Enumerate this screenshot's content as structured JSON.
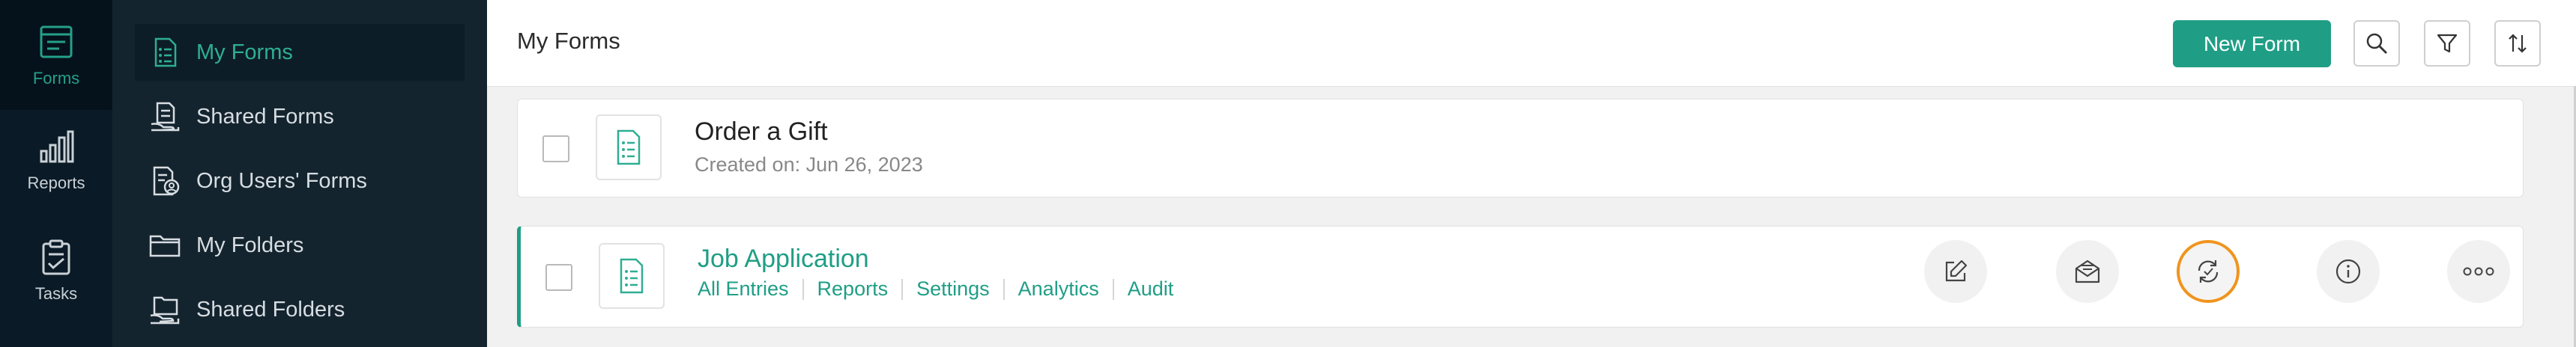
{
  "rail": {
    "items": [
      {
        "label": "Forms",
        "icon": "forms-icon",
        "active": true
      },
      {
        "label": "Reports",
        "icon": "bar-chart-icon",
        "active": false
      },
      {
        "label": "Tasks",
        "icon": "clipboard-check-icon",
        "active": false
      }
    ]
  },
  "sidebar": {
    "items": [
      {
        "label": "My Forms",
        "icon": "form-document-icon",
        "active": true
      },
      {
        "label": "Shared Forms",
        "icon": "shared-form-icon",
        "active": false
      },
      {
        "label": "Org Users' Forms",
        "icon": "org-form-icon",
        "active": false
      },
      {
        "label": "My Folders",
        "icon": "folder-icon",
        "active": false
      },
      {
        "label": "Shared Folders",
        "icon": "shared-folder-icon",
        "active": false
      }
    ]
  },
  "header": {
    "title": "My Forms",
    "new_form_label": "New Form"
  },
  "forms": [
    {
      "name": "Order a Gift",
      "created": "Created on: Jun 26, 2023"
    },
    {
      "name": "Job Application",
      "links": [
        "All Entries",
        "Reports",
        "Settings",
        "Analytics",
        "Audit"
      ]
    }
  ],
  "colors": {
    "accent": "#1f9e85",
    "highlight": "#f0941e",
    "rail_bg": "#0a1a26",
    "sidebar_bg": "#14242f"
  }
}
